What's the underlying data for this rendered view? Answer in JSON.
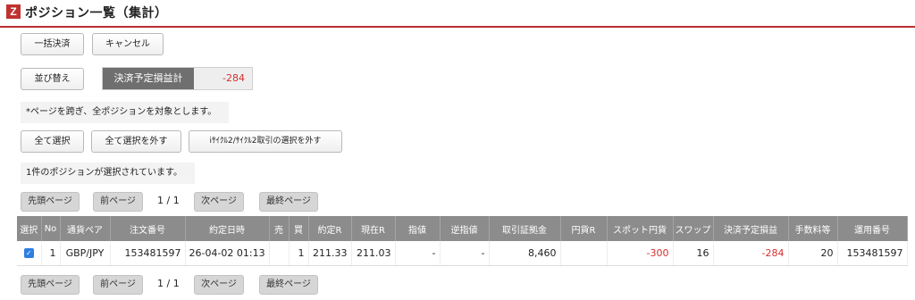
{
  "header": {
    "logo": "Z",
    "title": "ポジション一覧（集計）"
  },
  "buttons": {
    "bulk_settle": "一括決済",
    "cancel": "キャンセル",
    "sort": "並び替え",
    "select_all": "全て選択",
    "deselect_all": "全て選択を外す",
    "deselect_icycle": "iｻｲｸﾙ2/ｻｲｸﾙ2取引の選択を外す"
  },
  "pl_summary": {
    "label": "決済予定損益計",
    "value": "-284"
  },
  "notes": {
    "cross_page": "*ページを跨ぎ、全ポジションを対象とします。",
    "selected_count": "1件のポジションが選択されています。"
  },
  "pagination": {
    "first": "先頭ページ",
    "prev": "前ページ",
    "info": "1 / 1",
    "next": "次ページ",
    "last": "最終ページ"
  },
  "table": {
    "headers": [
      "選択",
      "No",
      "通貨ペア",
      "注文番号",
      "約定日時",
      "売",
      "買",
      "約定R",
      "現在R",
      "指値",
      "逆指値",
      "取引証拠金",
      "円貨R",
      "スポット円貨",
      "スワップ",
      "決済予定損益",
      "手数料等",
      "運用番号"
    ],
    "rows": [
      {
        "selected": true,
        "no": "1",
        "pair": "GBP/JPY",
        "order_no": "153481597",
        "exec_time": "26-04-02 01:13",
        "sell": "",
        "buy": "1",
        "exec_rate": "211.33",
        "current_rate": "211.03",
        "limit": "-",
        "stop": "-",
        "margin": "8,460",
        "jpy_rate": "",
        "spot_jpy": "-300",
        "swap": "16",
        "settle_pl": "-284",
        "fee": "20",
        "mgmt_no": "153481597"
      }
    ]
  },
  "colors": {
    "brand": "#c0322f",
    "negative": "#d53030",
    "header_bg": "#8c8c8c",
    "checkbox": "#2f7ee2"
  }
}
